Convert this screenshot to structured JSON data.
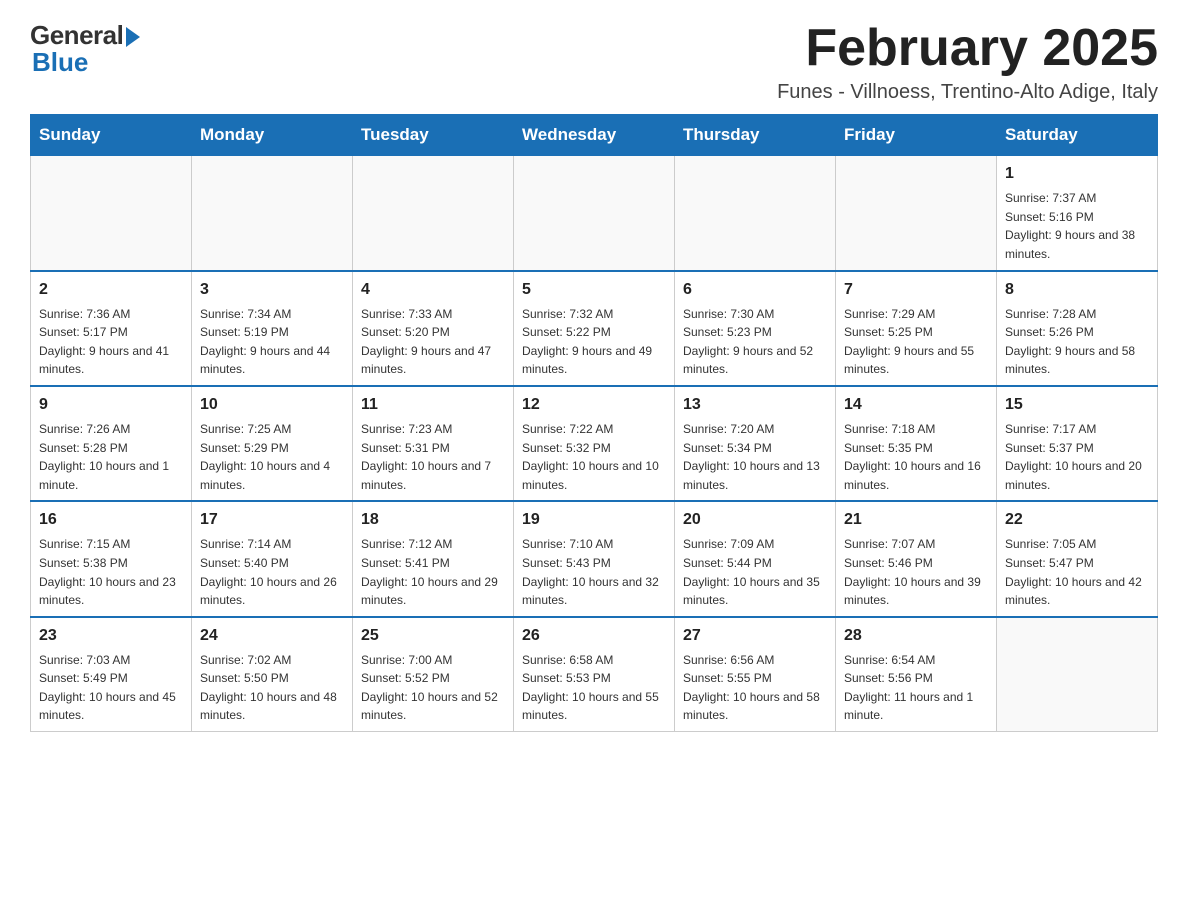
{
  "logo": {
    "general": "General",
    "blue": "Blue"
  },
  "title": "February 2025",
  "subtitle": "Funes - Villnoess, Trentino-Alto Adige, Italy",
  "days_of_week": [
    "Sunday",
    "Monday",
    "Tuesday",
    "Wednesday",
    "Thursday",
    "Friday",
    "Saturday"
  ],
  "weeks": [
    [
      {
        "day": "",
        "info": ""
      },
      {
        "day": "",
        "info": ""
      },
      {
        "day": "",
        "info": ""
      },
      {
        "day": "",
        "info": ""
      },
      {
        "day": "",
        "info": ""
      },
      {
        "day": "",
        "info": ""
      },
      {
        "day": "1",
        "info": "Sunrise: 7:37 AM\nSunset: 5:16 PM\nDaylight: 9 hours and 38 minutes."
      }
    ],
    [
      {
        "day": "2",
        "info": "Sunrise: 7:36 AM\nSunset: 5:17 PM\nDaylight: 9 hours and 41 minutes."
      },
      {
        "day": "3",
        "info": "Sunrise: 7:34 AM\nSunset: 5:19 PM\nDaylight: 9 hours and 44 minutes."
      },
      {
        "day": "4",
        "info": "Sunrise: 7:33 AM\nSunset: 5:20 PM\nDaylight: 9 hours and 47 minutes."
      },
      {
        "day": "5",
        "info": "Sunrise: 7:32 AM\nSunset: 5:22 PM\nDaylight: 9 hours and 49 minutes."
      },
      {
        "day": "6",
        "info": "Sunrise: 7:30 AM\nSunset: 5:23 PM\nDaylight: 9 hours and 52 minutes."
      },
      {
        "day": "7",
        "info": "Sunrise: 7:29 AM\nSunset: 5:25 PM\nDaylight: 9 hours and 55 minutes."
      },
      {
        "day": "8",
        "info": "Sunrise: 7:28 AM\nSunset: 5:26 PM\nDaylight: 9 hours and 58 minutes."
      }
    ],
    [
      {
        "day": "9",
        "info": "Sunrise: 7:26 AM\nSunset: 5:28 PM\nDaylight: 10 hours and 1 minute."
      },
      {
        "day": "10",
        "info": "Sunrise: 7:25 AM\nSunset: 5:29 PM\nDaylight: 10 hours and 4 minutes."
      },
      {
        "day": "11",
        "info": "Sunrise: 7:23 AM\nSunset: 5:31 PM\nDaylight: 10 hours and 7 minutes."
      },
      {
        "day": "12",
        "info": "Sunrise: 7:22 AM\nSunset: 5:32 PM\nDaylight: 10 hours and 10 minutes."
      },
      {
        "day": "13",
        "info": "Sunrise: 7:20 AM\nSunset: 5:34 PM\nDaylight: 10 hours and 13 minutes."
      },
      {
        "day": "14",
        "info": "Sunrise: 7:18 AM\nSunset: 5:35 PM\nDaylight: 10 hours and 16 minutes."
      },
      {
        "day": "15",
        "info": "Sunrise: 7:17 AM\nSunset: 5:37 PM\nDaylight: 10 hours and 20 minutes."
      }
    ],
    [
      {
        "day": "16",
        "info": "Sunrise: 7:15 AM\nSunset: 5:38 PM\nDaylight: 10 hours and 23 minutes."
      },
      {
        "day": "17",
        "info": "Sunrise: 7:14 AM\nSunset: 5:40 PM\nDaylight: 10 hours and 26 minutes."
      },
      {
        "day": "18",
        "info": "Sunrise: 7:12 AM\nSunset: 5:41 PM\nDaylight: 10 hours and 29 minutes."
      },
      {
        "day": "19",
        "info": "Sunrise: 7:10 AM\nSunset: 5:43 PM\nDaylight: 10 hours and 32 minutes."
      },
      {
        "day": "20",
        "info": "Sunrise: 7:09 AM\nSunset: 5:44 PM\nDaylight: 10 hours and 35 minutes."
      },
      {
        "day": "21",
        "info": "Sunrise: 7:07 AM\nSunset: 5:46 PM\nDaylight: 10 hours and 39 minutes."
      },
      {
        "day": "22",
        "info": "Sunrise: 7:05 AM\nSunset: 5:47 PM\nDaylight: 10 hours and 42 minutes."
      }
    ],
    [
      {
        "day": "23",
        "info": "Sunrise: 7:03 AM\nSunset: 5:49 PM\nDaylight: 10 hours and 45 minutes."
      },
      {
        "day": "24",
        "info": "Sunrise: 7:02 AM\nSunset: 5:50 PM\nDaylight: 10 hours and 48 minutes."
      },
      {
        "day": "25",
        "info": "Sunrise: 7:00 AM\nSunset: 5:52 PM\nDaylight: 10 hours and 52 minutes."
      },
      {
        "day": "26",
        "info": "Sunrise: 6:58 AM\nSunset: 5:53 PM\nDaylight: 10 hours and 55 minutes."
      },
      {
        "day": "27",
        "info": "Sunrise: 6:56 AM\nSunset: 5:55 PM\nDaylight: 10 hours and 58 minutes."
      },
      {
        "day": "28",
        "info": "Sunrise: 6:54 AM\nSunset: 5:56 PM\nDaylight: 11 hours and 1 minute."
      },
      {
        "day": "",
        "info": ""
      }
    ]
  ]
}
